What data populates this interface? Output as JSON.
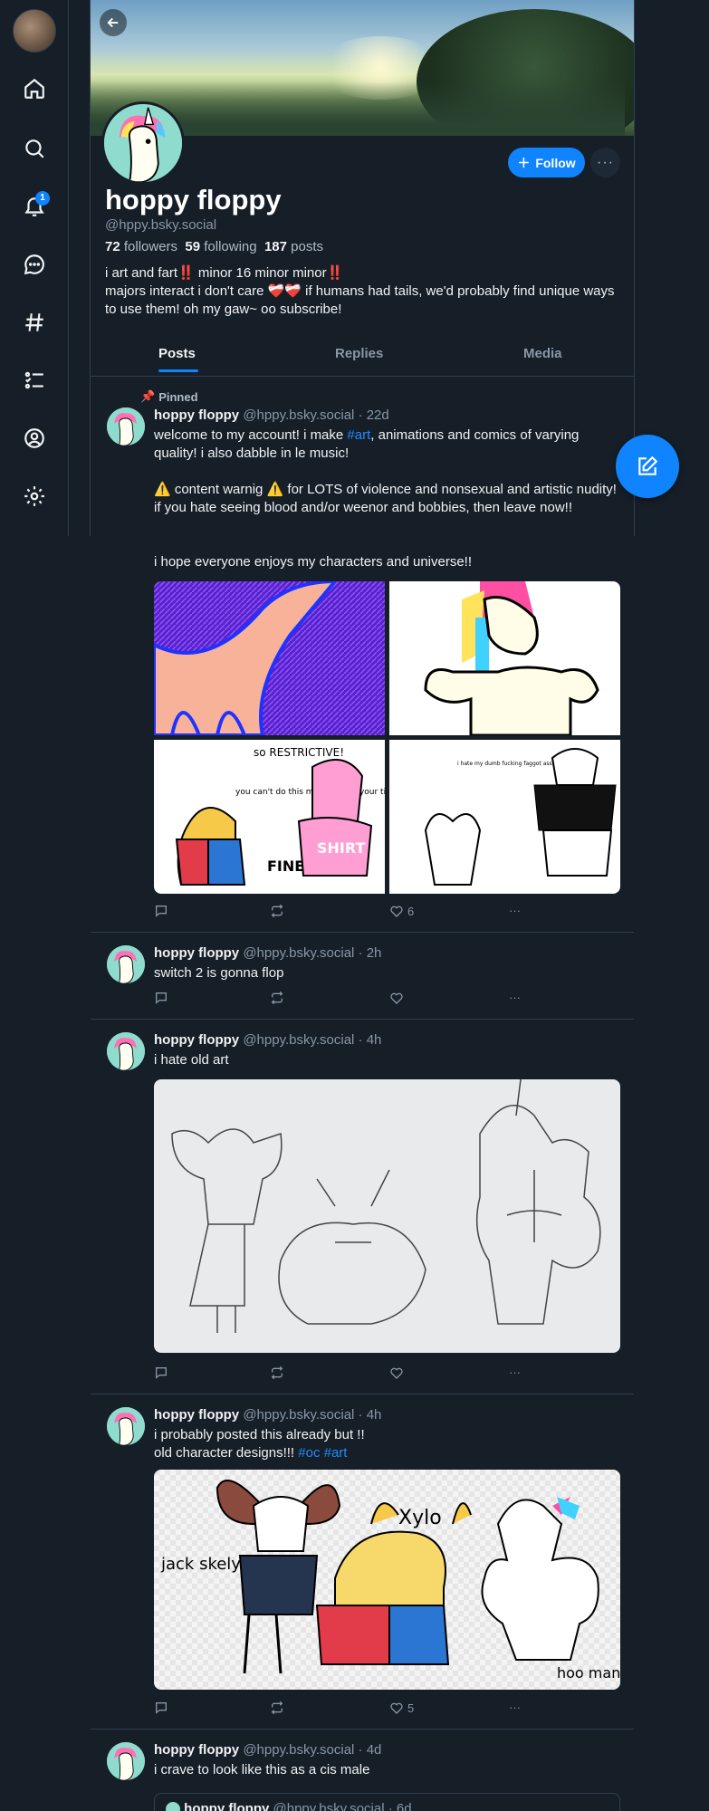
{
  "nav": {
    "notifications_badge": "1",
    "items": [
      "home-icon",
      "search-icon",
      "bell-icon",
      "chat-icon",
      "hashtag-icon",
      "list-icon",
      "profile-icon",
      "gear-icon"
    ]
  },
  "profile": {
    "display_name": "hoppy floppy",
    "handle": "@hppy.bsky.social",
    "followers_count": "72",
    "followers_label": "followers",
    "following_count": "59",
    "following_label": "following",
    "posts_count": "187",
    "posts_label": "posts",
    "bio_line1": "i art and fart‼️ minor 16 minor minor‼️",
    "bio_line2": "majors interact i don't care ❤️‍🩹❤️‍🩹 if humans had tails, we'd probably find unique ways to use them! oh my gaw~ oo subscribe!",
    "follow_label": "Follow",
    "more_label": "···"
  },
  "tabs": [
    "Posts",
    "Replies",
    "Media"
  ],
  "pinned_label": "Pinned",
  "posts": [
    {
      "name": "hoppy floppy",
      "meta": "@hppy.bsky.social · 22d",
      "text_a": "welcome to my account! i make ",
      "tag": "#art",
      "text_b": ", animations and comics of varying quality! i also dabble in le music!",
      "text_c": "⚠️ content warnig ⚠️ for LOTS of violence and nonsexual and artistic nudity! if you hate seeing blood and/or weenor and bobbies, then leave now!!",
      "text_d": "i hope everyone enjoys my characters and universe!!",
      "likes": "6"
    },
    {
      "name": "hoppy floppy",
      "meta": "@hppy.bsky.social · 2h",
      "text": "switch 2 is gonna flop",
      "likes": ""
    },
    {
      "name": "hoppy floppy",
      "meta": "@hppy.bsky.social · 4h",
      "text": "i hate old art",
      "likes": ""
    },
    {
      "name": "hoppy floppy",
      "meta": "@hppy.bsky.social · 4h",
      "text_a": "i probably posted this already but !!",
      "text_b": "old character designs!!! ",
      "tag1": "#oc",
      "tag2": "#art",
      "likes": "5"
    },
    {
      "name": "hoppy floppy",
      "meta": "@hppy.bsky.social · 4d",
      "text": "i crave to look like this as a cis male",
      "quote_name": "hoppy floppy",
      "quote_meta": "@hppy.bsky.social · 6d"
    }
  ],
  "drawing_text": {
    "restrictive": "so RESTRICTIVE!",
    "mission": "you can't do this mission with your tits out!",
    "fine": "FINE.",
    "shirt": "SHIRT",
    "dumb": "i hate my dumb fucking faggot ass",
    "xylo": "Xylo",
    "jack": "jack skely",
    "hoo": "hoo mane"
  },
  "colors": {
    "accent": "#1083fe",
    "bg": "#161e27",
    "border": "#2e4052",
    "muted": "#8797a8"
  }
}
